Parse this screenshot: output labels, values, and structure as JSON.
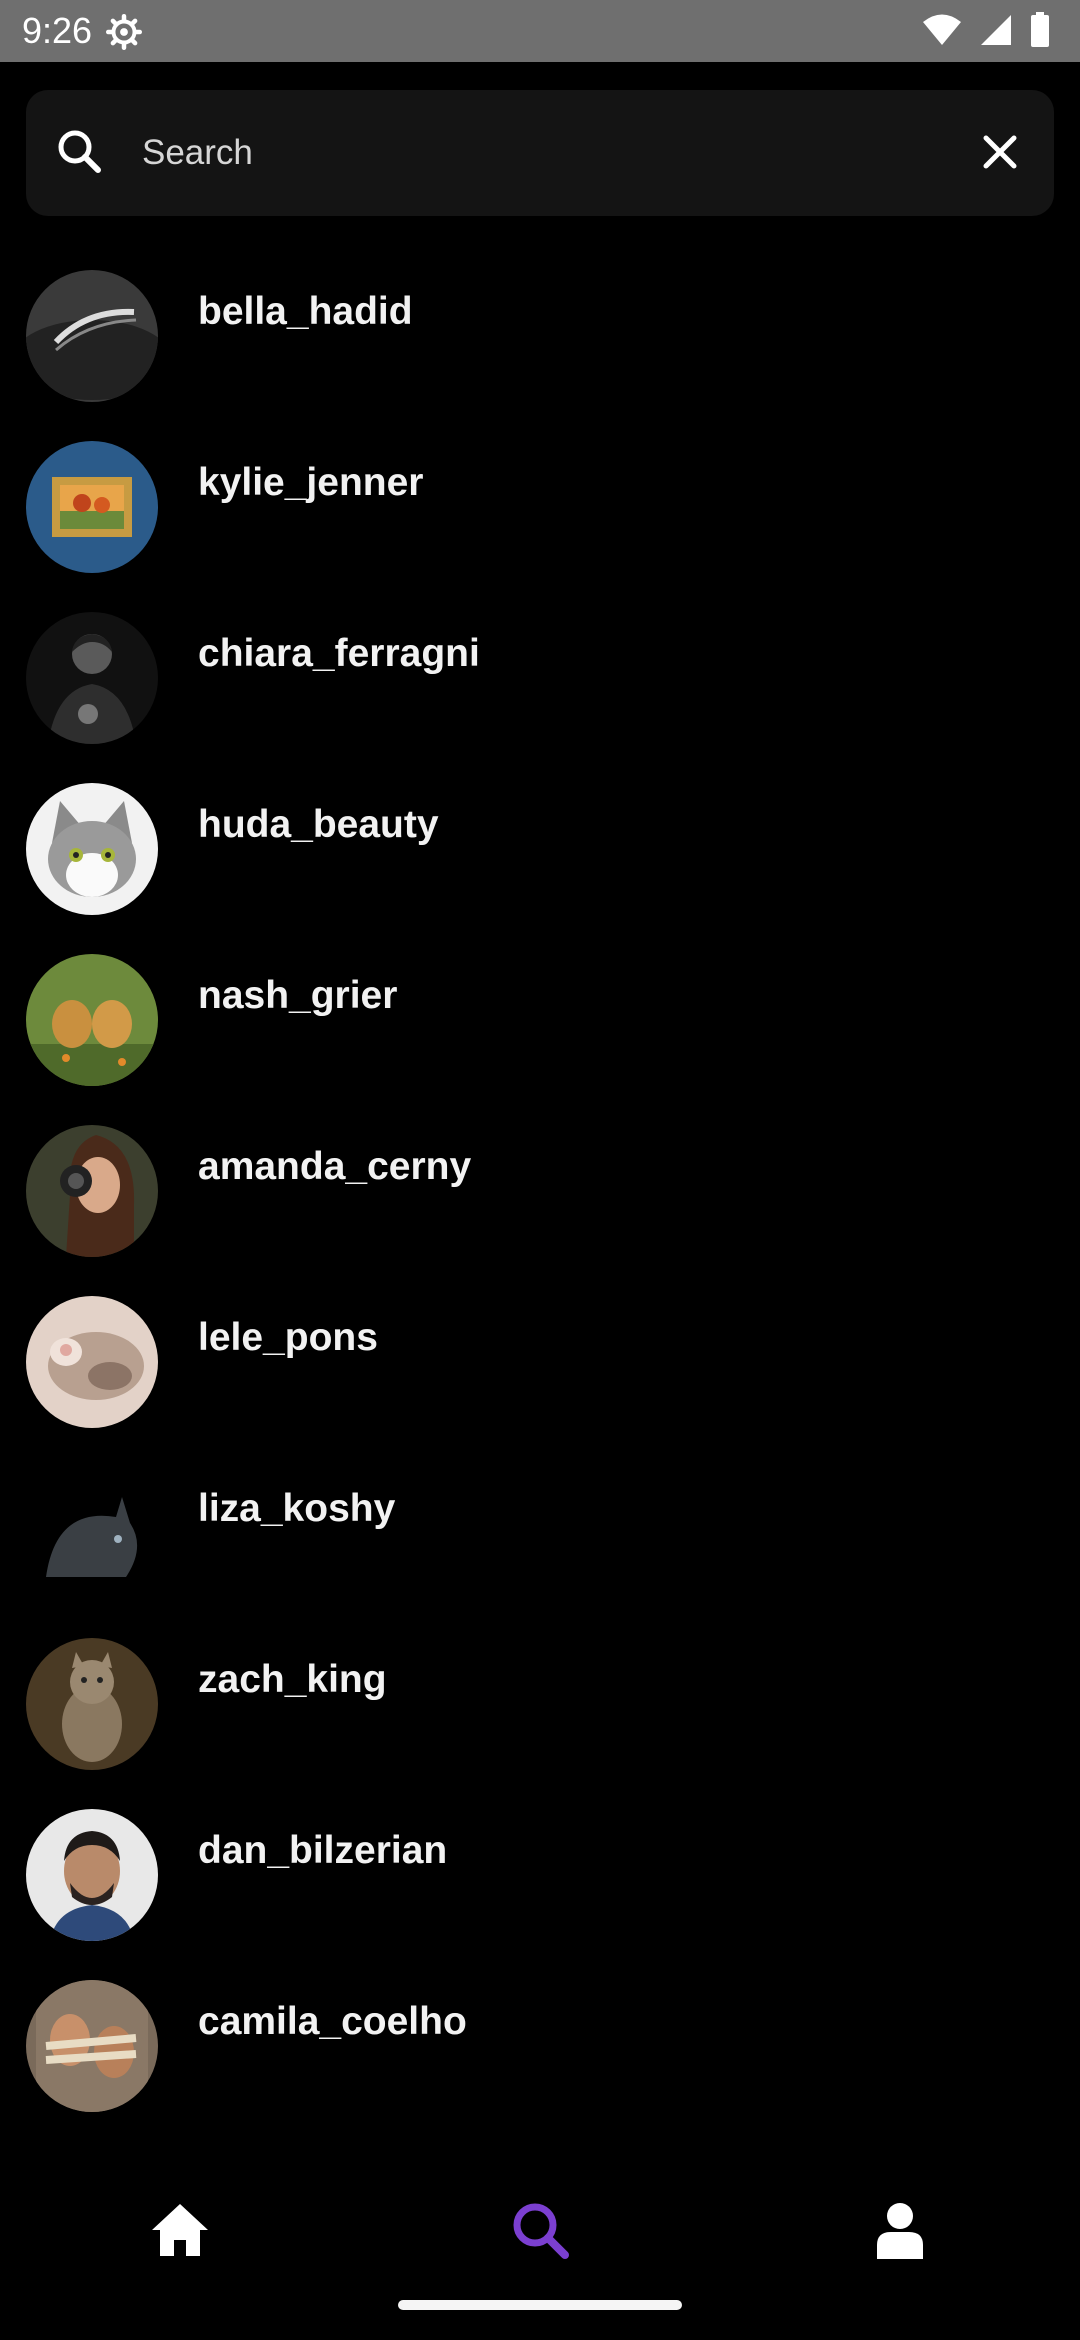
{
  "status_bar": {
    "time": "9:26",
    "icons": [
      "settings-icon",
      "wifi-icon",
      "signal-icon",
      "battery-icon"
    ]
  },
  "search": {
    "placeholder": "Search",
    "value": ""
  },
  "users": [
    {
      "username": "bella_hadid"
    },
    {
      "username": "kylie_jenner"
    },
    {
      "username": "chiara_ferragni"
    },
    {
      "username": "huda_beauty"
    },
    {
      "username": "nash_grier"
    },
    {
      "username": "amanda_cerny"
    },
    {
      "username": "lele_pons"
    },
    {
      "username": "liza_koshy"
    },
    {
      "username": "zach_king"
    },
    {
      "username": "dan_bilzerian"
    },
    {
      "username": "camila_coelho"
    }
  ],
  "bottom_nav": {
    "items": [
      {
        "icon": "home-icon",
        "active": false
      },
      {
        "icon": "search-icon",
        "active": true
      },
      {
        "icon": "profile-icon",
        "active": false
      }
    ],
    "active_color": "#7b3fd0",
    "inactive_color": "#ffffff"
  },
  "colors": {
    "background": "#000000",
    "search_bar": "#141414",
    "status_bar": "#6f6f6f"
  }
}
